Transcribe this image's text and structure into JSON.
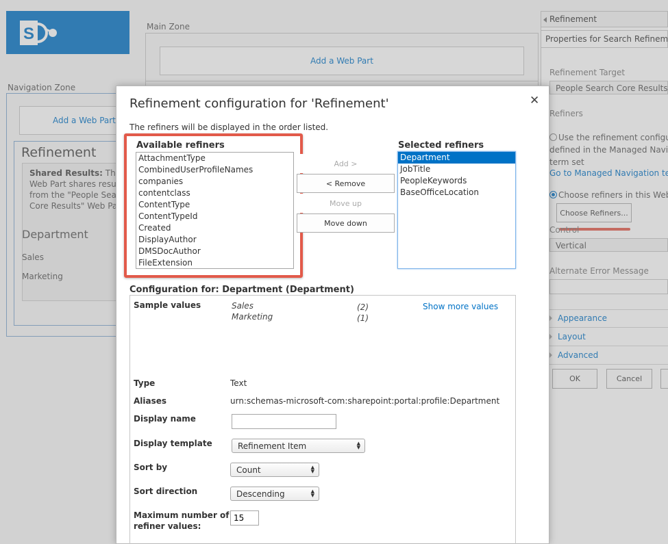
{
  "background": {
    "main_zone_label": "Main Zone",
    "add_web_part_main": "Add a Web Part",
    "navigation_zone_label": "Navigation Zone",
    "add_web_part_nav": "Add a Web Part",
    "refinement_title": "Refinement",
    "shared_results_bold": "Shared Results:",
    "shared_results_line1": " This",
    "shared_results_line2": "Web Part shares results",
    "shared_results_line3": "from the \"People Search",
    "shared_results_line4": "Core Results\" Web Part",
    "department_title": "Department",
    "facets": [
      "Sales",
      "Marketing"
    ]
  },
  "toolpane": {
    "header": "Refinement",
    "properties_title": "Properties for Search Refinement",
    "refinement_target_label": "Refinement Target",
    "refinement_target_value": "People Search Core Results -",
    "refiners_label": "Refiners",
    "option_managed_line1": "Use the refinement configu",
    "option_managed_line2": "defined in the Managed Navig",
    "option_managed_line3": "term set",
    "managed_nav_link": "Go to Managed Navigation term",
    "option_choose": "Choose refiners in this Web",
    "choose_refiners_button": "Choose Refiners...",
    "control_label": "Control",
    "control_value": "Vertical",
    "alt_error_label": "Alternate Error Message",
    "sections": [
      "Appearance",
      "Layout",
      "Advanced"
    ],
    "ok_button": "OK",
    "cancel_button": "Cancel"
  },
  "dialog": {
    "title": "Refinement configuration for 'Refinement'",
    "close_glyph": "✕",
    "intro": "The refiners will be displayed in the order listed.",
    "available_heading": "Available refiners",
    "available": [
      "AttachmentType",
      "CombinedUserProfileNames",
      "companies",
      "contentclass",
      "ContentType",
      "ContentTypeId",
      "Created",
      "DisplayAuthor",
      "DMSDocAuthor",
      "FileExtension"
    ],
    "buttons": {
      "add": "Add >",
      "remove": "< Remove",
      "move_up": "Move up",
      "move_down": "Move down"
    },
    "selected_heading": "Selected refiners",
    "selected": [
      "Department",
      "JobTitle",
      "PeopleKeywords",
      "BaseOfficeLocation"
    ],
    "selected_index": 0,
    "config_heading": "Configuration for: Department (Department)",
    "config": {
      "sample_values_label": "Sample values",
      "samples": [
        {
          "name": "Sales",
          "count": "(2)"
        },
        {
          "name": "Marketing",
          "count": "(1)"
        }
      ],
      "show_more": "Show more values",
      "type_label": "Type",
      "type_value": "Text",
      "aliases_label": "Aliases",
      "aliases_value": "urn:schemas-microsoft-com:sharepoint:portal:profile:Department",
      "display_name_label": "Display name",
      "display_name_value": "",
      "display_template_label": "Display template",
      "display_template_value": "Refinement Item",
      "sort_by_label": "Sort by",
      "sort_by_value": "Count",
      "sort_direction_label": "Sort direction",
      "sort_direction_value": "Descending",
      "max_values_label_line1": "Maximum number of",
      "max_values_label_line2": "refiner values:",
      "max_values_value": "15"
    }
  }
}
